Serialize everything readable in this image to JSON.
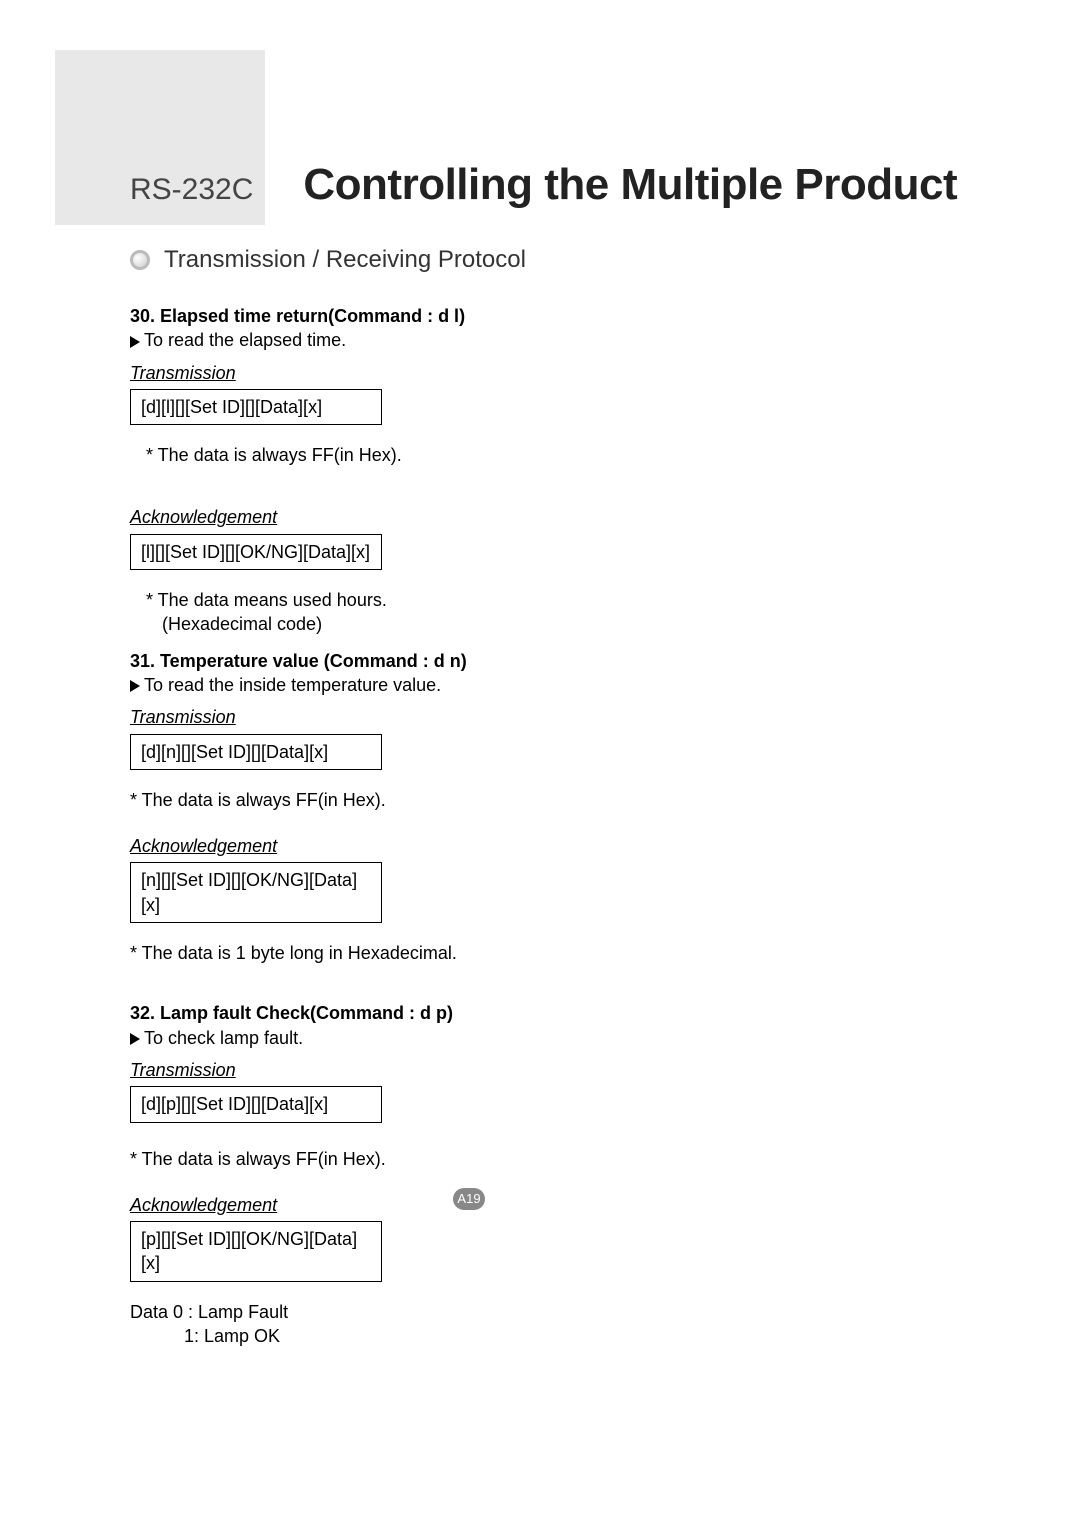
{
  "header": {
    "prefix": "RS-232C",
    "title": "Controlling the Multiple Product"
  },
  "section_title": "Transmission / Receiving Protocol",
  "commands": [
    {
      "title": "30. Elapsed time return(Command : d l)",
      "desc": "To read the elapsed time.",
      "transmission_label": "Transmission",
      "transmission_box": "[d][l][][Set ID][][Data][x]",
      "tx_note": "* The data is always FF(in Hex).",
      "ack_label": "Acknowledgement",
      "ack_box": "[l][][Set ID][][OK/NG][Data][x]",
      "ack_note1": "* The data means used hours.",
      "ack_note2": "(Hexadecimal code)"
    },
    {
      "title": "31. Temperature value (Command : d n)",
      "desc": "To read the inside temperature value.",
      "transmission_label": "Transmission",
      "transmission_box": "[d][n][][Set ID][][Data][x]",
      "tx_note": "* The data is always FF(in Hex).",
      "ack_label": "Acknowledgement",
      "ack_box": "[n][][Set ID][][OK/NG][Data][x]",
      "ack_note1": "* The data  is 1 byte long in Hexadecimal."
    },
    {
      "title": "32. Lamp fault Check(Command : d p)",
      "desc": "To check lamp fault.",
      "transmission_label": "Transmission",
      "transmission_box": "[d][p][][Set ID][][Data][x]",
      "tx_note": "* The data is always FF(in Hex).",
      "ack_label": "Acknowledgement",
      "ack_box": "[p][][Set ID][][OK/NG][Data][x]",
      "ack_data1": "Data 0 : Lamp Fault",
      "ack_data2": "1: Lamp OK"
    }
  ],
  "page_number": "A19"
}
